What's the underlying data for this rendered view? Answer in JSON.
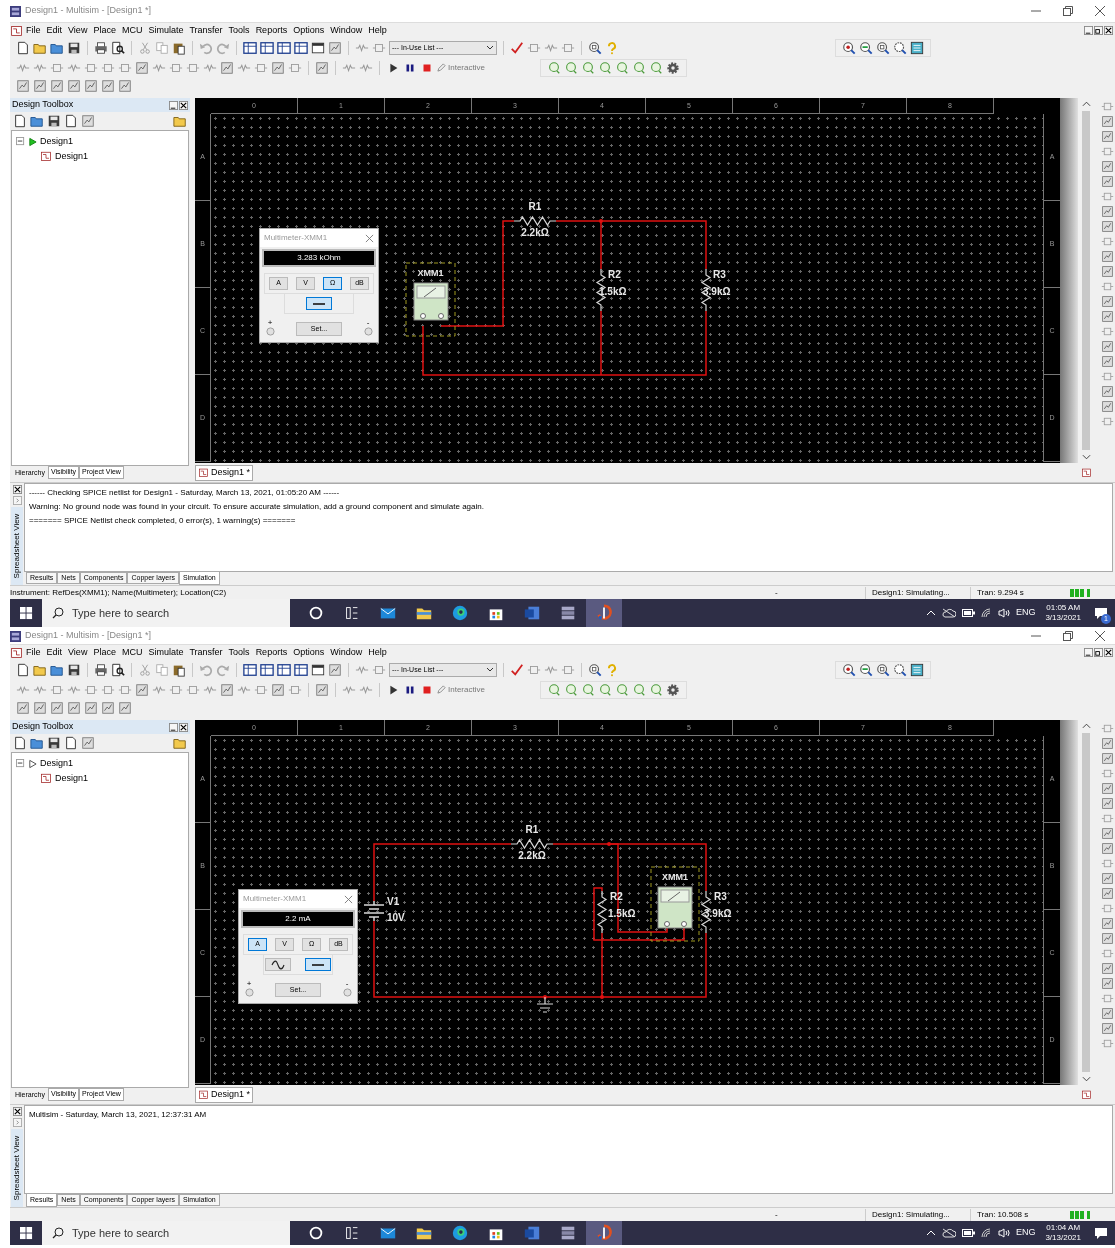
{
  "screens": [
    {
      "window": {
        "title": "Design1 - Multisim - [Design1 *]"
      },
      "menu": [
        "File",
        "Edit",
        "View",
        "Place",
        "MCU",
        "Simulate",
        "Transfer",
        "Tools",
        "Reports",
        "Options",
        "Window",
        "Help"
      ],
      "toolbar": {
        "component_list": "--- In-Use List ---",
        "mode_label": "Interactive"
      },
      "design_toolbox": {
        "title": "Design Toolbox",
        "tree": [
          {
            "label": "Design1",
            "active": true,
            "expanded": true,
            "children": [
              {
                "label": "Design1"
              }
            ]
          }
        ],
        "tabs": [
          {
            "label": "Hierarchy",
            "selected": true
          },
          {
            "label": "Visibility",
            "selected": false
          },
          {
            "label": "Project View",
            "selected": false
          }
        ]
      },
      "canvas": {
        "column_labels": [
          "0",
          "1",
          "2",
          "3",
          "4",
          "5",
          "6",
          "7",
          "8"
        ],
        "row_labels_left": [
          "A",
          "B",
          "C",
          "D"
        ],
        "row_labels_right": [
          "A",
          "B",
          "C",
          "D"
        ],
        "components": [
          {
            "kind": "multimeter",
            "ref": "XMM1"
          },
          {
            "kind": "resistor",
            "ref": "R1",
            "value": "2.2kΩ"
          },
          {
            "kind": "resistor",
            "ref": "R2",
            "value": "1.5kΩ"
          },
          {
            "kind": "resistor",
            "ref": "R3",
            "value": "3.9kΩ"
          }
        ],
        "multimeter_window": {
          "title": "Multimeter-XMM1",
          "reading": "3.283 kOhm",
          "modes": [
            {
              "label": "A",
              "selected": false
            },
            {
              "label": "V",
              "selected": false
            },
            {
              "label": "Ω",
              "selected": true
            },
            {
              "label": "dB",
              "selected": false
            }
          ],
          "signal_buttons": [
            {
              "kind": "dc",
              "selected": true
            }
          ],
          "set_button": "Set...",
          "plus": "+",
          "minus": "-"
        },
        "tab": "Design1 *"
      },
      "spreadsheet": {
        "title": "Spreadsheet View",
        "lines": [
          "------ Checking SPICE netlist for Design1 - Saturday, March 13, 2021, 01:05:20 AM ------",
          "Warning: No ground node was found in your circuit. To ensure accurate simulation, add a ground component and simulate again.",
          "======= SPICE Netlist check completed, 0 error(s), 1 warning(s) ======="
        ],
        "tabs": [
          {
            "label": "Results",
            "selected": false
          },
          {
            "label": "Nets",
            "selected": false
          },
          {
            "label": "Components",
            "selected": false
          },
          {
            "label": "Copper layers",
            "selected": false
          },
          {
            "label": "Simulation",
            "selected": true
          }
        ]
      },
      "status_bar": {
        "message": "Instrument: RefDes(XMM1); Name(Multimeter); Location(C2)",
        "field_2": "-",
        "simulation": "Design1: Simulating...",
        "tran": "Tran: 9.294 s"
      },
      "taskbar": {
        "search_placeholder": "Type here to search",
        "language": "ENG",
        "time": "01:05 AM",
        "date": "3/13/2021",
        "notifications": "1"
      }
    },
    {
      "window": {
        "title": "Design1 - Multisim - [Design1 *]"
      },
      "menu": [
        "File",
        "Edit",
        "View",
        "Place",
        "MCU",
        "Simulate",
        "Transfer",
        "Tools",
        "Reports",
        "Options",
        "Window",
        "Help"
      ],
      "toolbar": {
        "component_list": "--- In-Use List ---",
        "mode_label": "Interactive"
      },
      "design_toolbox": {
        "title": "Design Toolbox",
        "tree": [
          {
            "label": "Design1",
            "active": false,
            "expanded": true,
            "children": [
              {
                "label": "Design1"
              }
            ]
          }
        ],
        "tabs": [
          {
            "label": "Hierarchy",
            "selected": true
          },
          {
            "label": "Visibility",
            "selected": false
          },
          {
            "label": "Project View",
            "selected": false
          }
        ]
      },
      "canvas": {
        "column_labels": [
          "0",
          "1",
          "2",
          "3",
          "4",
          "5",
          "6",
          "7",
          "8"
        ],
        "row_labels_left": [
          "A",
          "B",
          "C",
          "D"
        ],
        "row_labels_right": [
          "A",
          "B",
          "C",
          "D"
        ],
        "components": [
          {
            "kind": "battery",
            "ref": "V1",
            "value": "10V"
          },
          {
            "kind": "resistor",
            "ref": "R1",
            "value": "2.2kΩ"
          },
          {
            "kind": "resistor",
            "ref": "R2",
            "value": "1.5kΩ"
          },
          {
            "kind": "multimeter",
            "ref": "XMM1"
          },
          {
            "kind": "resistor",
            "ref": "R3",
            "value": "3.9kΩ"
          },
          {
            "kind": "ground"
          }
        ],
        "multimeter_window": {
          "title": "Multimeter-XMM1",
          "reading": "2.2 mA",
          "modes": [
            {
              "label": "A",
              "selected": true
            },
            {
              "label": "V",
              "selected": false
            },
            {
              "label": "Ω",
              "selected": false
            },
            {
              "label": "dB",
              "selected": false
            }
          ],
          "signal_buttons": [
            {
              "kind": "ac",
              "selected": false
            },
            {
              "kind": "dc",
              "selected": true
            }
          ],
          "set_button": "Set...",
          "plus": "+",
          "minus": "-"
        },
        "tab": "Design1 *"
      },
      "spreadsheet": {
        "title": "Spreadsheet View",
        "lines": [
          "Multisim  -  Saturday, March 13, 2021, 12:37:31 AM"
        ],
        "tabs": [
          {
            "label": "Results",
            "selected": true
          },
          {
            "label": "Nets",
            "selected": false
          },
          {
            "label": "Components",
            "selected": false
          },
          {
            "label": "Copper layers",
            "selected": false
          },
          {
            "label": "Simulation",
            "selected": false
          }
        ]
      },
      "status_bar": {
        "field_2": "-",
        "simulation": "Design1: Simulating...",
        "tran": "Tran: 10.508 s"
      },
      "taskbar": {
        "search_placeholder": "Type here to search",
        "language": "ENG",
        "time": "01:04 AM",
        "date": "3/13/2021"
      }
    }
  ]
}
